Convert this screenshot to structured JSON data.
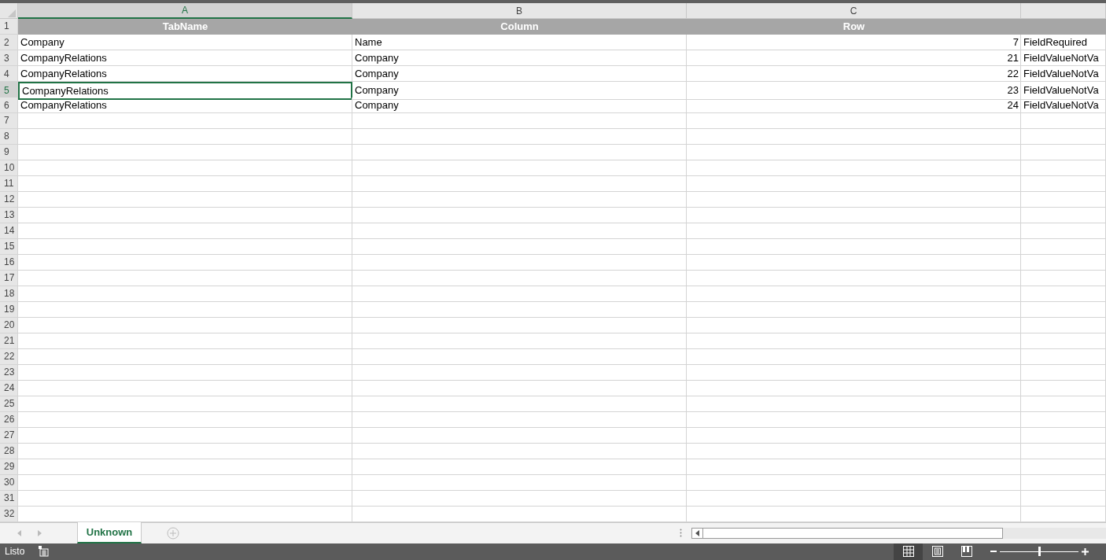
{
  "columns": [
    {
      "letter": "A",
      "selected": true,
      "kind": "text"
    },
    {
      "letter": "B",
      "selected": false,
      "kind": "text"
    },
    {
      "letter": "C",
      "selected": false,
      "kind": "number"
    },
    {
      "kind": "text",
      "selected": false
    }
  ],
  "rows": [
    {
      "number": "1",
      "selected": false,
      "kind": "header",
      "cells": [
        "TabName",
        "Column",
        "Row"
      ]
    },
    {
      "number": "2",
      "selected": false,
      "kind": "data",
      "cells": [
        "Company",
        "Name",
        "7",
        "FieldRequired"
      ]
    },
    {
      "number": "3",
      "selected": false,
      "kind": "data",
      "cells": [
        "CompanyRelations",
        "Company",
        "21",
        "FieldValueNotVa"
      ]
    },
    {
      "number": "4",
      "selected": false,
      "kind": "data",
      "cells": [
        "CompanyRelations",
        "Company",
        "22",
        "FieldValueNotVa"
      ]
    },
    {
      "number": "5",
      "selected": true,
      "kind": "data",
      "cells": [
        "CompanyRelations",
        "Company",
        "23",
        "FieldValueNotVa"
      ]
    },
    {
      "number": "6",
      "selected": false,
      "kind": "data",
      "cells": [
        "CompanyRelations",
        "Company",
        "24",
        "FieldValueNotVa"
      ]
    },
    {
      "number": "7",
      "selected": false,
      "kind": "data"
    },
    {
      "number": "8",
      "selected": false,
      "kind": "data"
    },
    {
      "number": "9",
      "selected": false,
      "kind": "data"
    },
    {
      "number": "10",
      "selected": false,
      "kind": "data"
    },
    {
      "number": "11",
      "selected": false,
      "kind": "data"
    },
    {
      "number": "12",
      "selected": false,
      "kind": "data"
    },
    {
      "number": "13",
      "selected": false,
      "kind": "data"
    },
    {
      "number": "14",
      "selected": false,
      "kind": "data"
    },
    {
      "number": "15",
      "selected": false,
      "kind": "data"
    },
    {
      "number": "16",
      "selected": false,
      "kind": "data"
    },
    {
      "number": "17",
      "selected": false,
      "kind": "data"
    },
    {
      "number": "18",
      "selected": false,
      "kind": "data"
    },
    {
      "number": "19",
      "selected": false,
      "kind": "data"
    },
    {
      "number": "20",
      "selected": false,
      "kind": "data"
    },
    {
      "number": "21",
      "selected": false,
      "kind": "data"
    },
    {
      "number": "22",
      "selected": false,
      "kind": "data"
    },
    {
      "number": "23",
      "selected": false,
      "kind": "data"
    },
    {
      "number": "24",
      "selected": false,
      "kind": "data"
    },
    {
      "number": "25",
      "selected": false,
      "kind": "data"
    },
    {
      "number": "26",
      "selected": false,
      "kind": "data"
    },
    {
      "number": "27",
      "selected": false,
      "kind": "data"
    },
    {
      "number": "28",
      "selected": false,
      "kind": "data"
    },
    {
      "number": "29",
      "selected": false,
      "kind": "data"
    },
    {
      "number": "30",
      "selected": false,
      "kind": "data"
    },
    {
      "number": "31",
      "selected": false,
      "kind": "data"
    },
    {
      "number": "32",
      "selected": false,
      "kind": "data"
    }
  ],
  "sheet_tabs": [
    {
      "label": "Unknown",
      "selected": true
    }
  ],
  "status_bar": {
    "text": "Listo",
    "views": [
      {
        "kind": "normal",
        "selected": true
      },
      {
        "kind": "page-layout",
        "selected": false
      },
      {
        "kind": "page-break",
        "selected": false
      }
    ],
    "zoom": {
      "level": 0.5
    }
  }
}
